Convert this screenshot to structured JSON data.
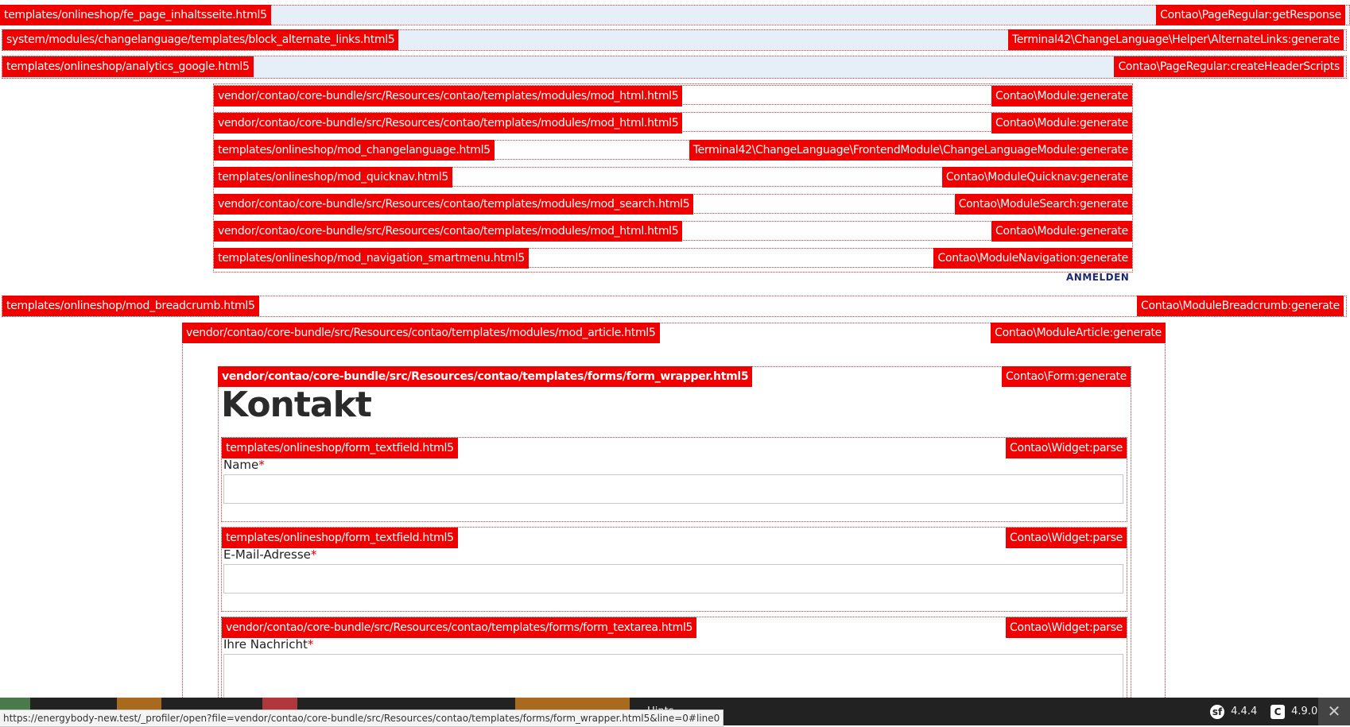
{
  "debug_overlay": {
    "rows": [
      {
        "template": "templates/onlineshop/fe_page_inhaltsseite.html5",
        "method": "Contao\\PageRegular:getResponse"
      },
      {
        "template": "system/modules/changelanguage/templates/block_alternate_links.html5",
        "method": "Terminal42\\ChangeLanguage\\Helper\\AlternateLinks:generate"
      },
      {
        "template": "templates/onlineshop/analytics_google.html5",
        "method": "Contao\\PageRegular:createHeaderScripts"
      },
      {
        "template": "vendor/contao/core-bundle/src/Resources/contao/templates/modules/mod_html.html5",
        "method": "Contao\\Module:generate"
      },
      {
        "template": "vendor/contao/core-bundle/src/Resources/contao/templates/modules/mod_html.html5",
        "method": "Contao\\Module:generate"
      },
      {
        "template": "templates/onlineshop/mod_changelanguage.html5",
        "method": "Terminal42\\ChangeLanguage\\FrontendModule\\ChangeLanguageModule:generate"
      },
      {
        "template": "templates/onlineshop/mod_quicknav.html5",
        "method": "Contao\\ModuleQuicknav:generate"
      },
      {
        "template": "vendor/contao/core-bundle/src/Resources/contao/templates/modules/mod_search.html5",
        "method": "Contao\\ModuleSearch:generate"
      },
      {
        "template": "vendor/contao/core-bundle/src/Resources/contao/templates/modules/mod_html.html5",
        "method": "Contao\\Module:generate"
      },
      {
        "template": "templates/onlineshop/mod_navigation_smartmenu.html5",
        "method": "Contao\\ModuleNavigation:generate"
      },
      {
        "template": "templates/onlineshop/mod_breadcrumb.html5",
        "method": "Contao\\ModuleBreadcrumb:generate"
      },
      {
        "template": "vendor/contao/core-bundle/src/Resources/contao/templates/modules/mod_article.html5",
        "method": "Contao\\ModuleArticle:generate"
      },
      {
        "template": "vendor/contao/core-bundle/src/Resources/contao/templates/forms/form_wrapper.html5",
        "method": "Contao\\Form:generate"
      },
      {
        "template": "templates/onlineshop/form_textfield.html5",
        "method": "Contao\\Widget:parse"
      },
      {
        "template": "templates/onlineshop/form_textfield.html5",
        "method": "Contao\\Widget:parse"
      },
      {
        "template": "vendor/contao/core-bundle/src/Resources/contao/templates/forms/form_textarea.html5",
        "method": "Contao\\Widget:parse"
      }
    ]
  },
  "header": {
    "login_label": "ANMELDEN"
  },
  "form": {
    "title": "Kontakt",
    "required_mark": "*",
    "fields": [
      {
        "label": "Name",
        "value": ""
      },
      {
        "label": "E-Mail-Adresse",
        "value": ""
      },
      {
        "label": "Ihre Nachricht",
        "value": ""
      }
    ]
  },
  "toolbar": {
    "hints_label": "Hints",
    "hints_state": "on",
    "symfony_version": "4.4.4",
    "contao_version": "4.9.0",
    "close_label": "✕"
  },
  "status_url": "https://energybody-new.test/_profiler/open?file=vendor/contao/core-bundle/src/Resources/contao/templates/forms/form_wrapper.html5&line=0#line0"
}
